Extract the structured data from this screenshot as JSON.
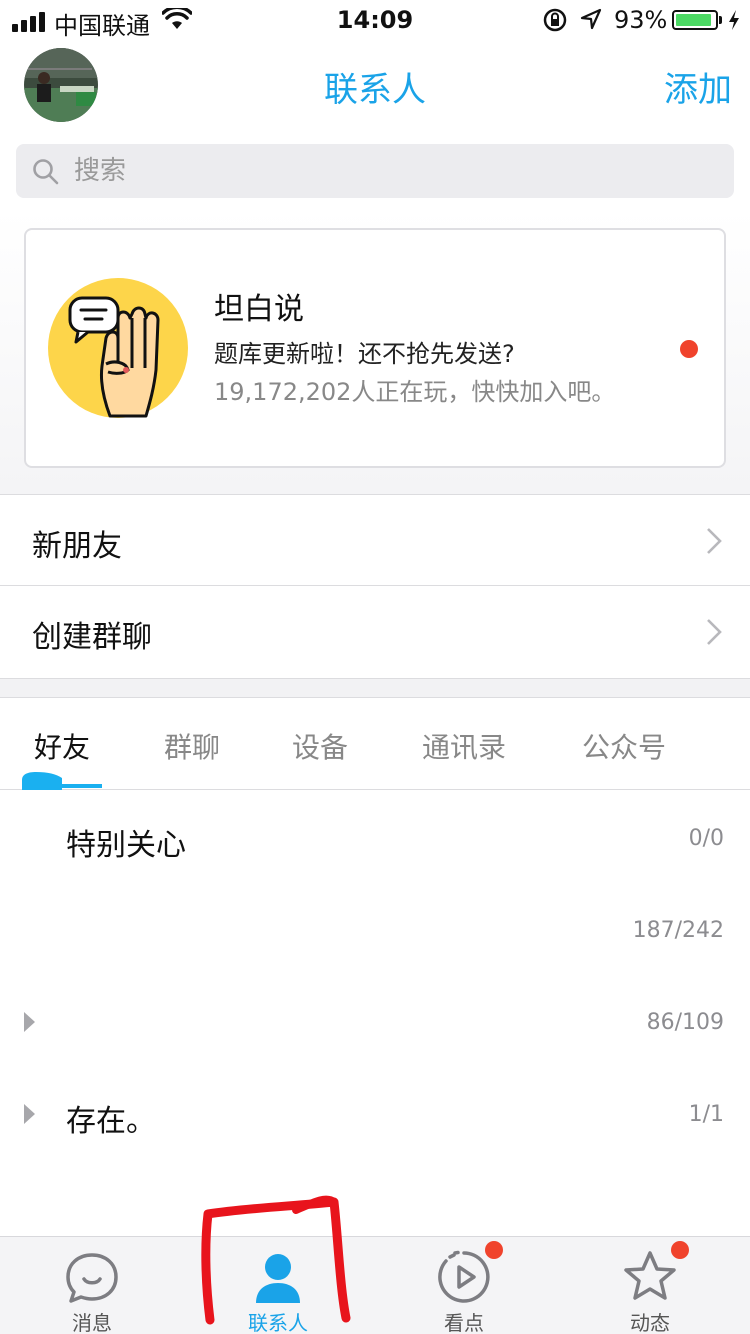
{
  "status_bar": {
    "carrier": "中国联通",
    "time": "14:09",
    "battery_pct": "93%",
    "battery_level": 0.93,
    "icons": [
      "signal-icon",
      "wifi-icon",
      "orientation-lock-icon",
      "location-icon",
      "battery-icon",
      "charging-icon"
    ]
  },
  "header": {
    "title": "联系人",
    "add_label": "添加"
  },
  "search": {
    "placeholder": "搜索"
  },
  "promo": {
    "title": "坦白说",
    "subtitle": "题库更新啦！还不抢先发送?",
    "players": "19,172,202人正在玩，快快加入吧。",
    "unread_dot": true
  },
  "menu": {
    "new_friends": "新朋友",
    "create_group": "创建群聊"
  },
  "tabs": [
    {
      "label": "好友",
      "active": true
    },
    {
      "label": "群聊",
      "active": false
    },
    {
      "label": "设备",
      "active": false
    },
    {
      "label": "通讯录",
      "active": false
    },
    {
      "label": "公众号",
      "active": false
    }
  ],
  "groups": [
    {
      "name": "特别关心",
      "count": "0/0",
      "collapsed_arrow": false
    },
    {
      "name": "",
      "count": "187/242",
      "collapsed_arrow": false
    },
    {
      "name": "",
      "count": "86/109",
      "collapsed_arrow": true
    },
    {
      "name": "存在。",
      "count": "1/1",
      "collapsed_arrow": true
    }
  ],
  "tabbar": [
    {
      "label": "消息",
      "icon": "message-bubble-icon",
      "active": false,
      "badge": false
    },
    {
      "label": "联系人",
      "icon": "contact-person-icon",
      "active": true,
      "badge": false
    },
    {
      "label": "看点",
      "icon": "play-circle-icon",
      "active": false,
      "badge": true
    },
    {
      "label": "动态",
      "icon": "star-icon",
      "active": false,
      "badge": true
    }
  ],
  "colors": {
    "accent": "#1aa3e8",
    "badge": "#f0432c",
    "battery": "#4cd964",
    "annotation": "#e8141c"
  }
}
